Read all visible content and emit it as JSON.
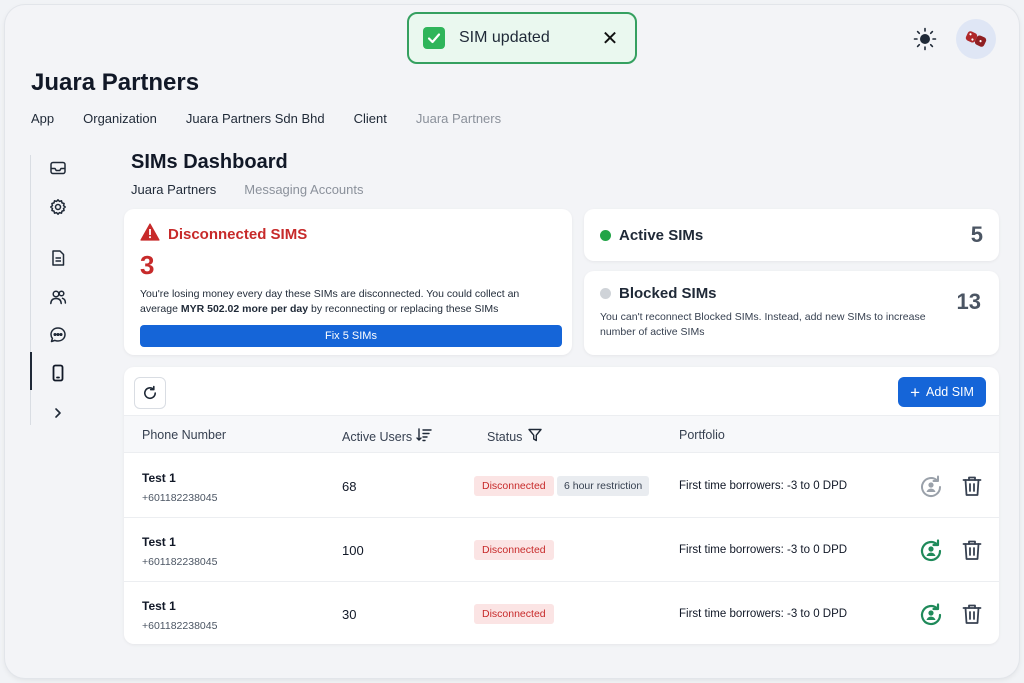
{
  "toast": {
    "message": "SIM updated",
    "close_label": "✕"
  },
  "header": {
    "org_title": "Juara Partners"
  },
  "breadcrumb": [
    "App",
    "Organization",
    "Juara Partners Sdn Bhd",
    "Client",
    "Juara Partners"
  ],
  "sidebar": {
    "items": [
      {
        "icon": "inbox-icon"
      },
      {
        "icon": "gear-icon"
      },
      {
        "icon": "document-icon"
      },
      {
        "icon": "users-icon"
      },
      {
        "icon": "chat-icon"
      },
      {
        "icon": "phone-icon",
        "active": true
      },
      {
        "icon": "chevron-right-icon"
      }
    ]
  },
  "dashboard": {
    "title": "SIMs Dashboard",
    "tabs": [
      "Juara Partners",
      "Messaging Accounts"
    ]
  },
  "disconnected": {
    "title": "Disconnected SIMS",
    "count": "3",
    "message_pre": "You're losing money every day these SIMs are disconnected. You could collect an average ",
    "message_bold": "MYR 502.02 more per day",
    "message_post": " by reconnecting or replacing these SIMs",
    "button_label": "Fix 5 SIMs",
    "color": "#c72a2a"
  },
  "active": {
    "label": "Active SIMs",
    "count": "5",
    "color": "#22a447"
  },
  "blocked": {
    "label": "Blocked SIMs",
    "count": "13",
    "message": "You can't reconnect Blocked SIMs. Instead, add new SIMs to increase number of active SIMs",
    "color": "#cfd3d8"
  },
  "table": {
    "add_label": "Add SIM",
    "columns": [
      "Phone Number",
      "Active Users",
      "Status",
      "Portfolio"
    ],
    "rows": [
      {
        "name": "Test 1",
        "number": "+601182238045",
        "users": "68",
        "status": "Disconnected",
        "restriction": "6 hour restriction",
        "portfolio": "First time borrowers: -3 to 0 DPD",
        "reconnect_enabled": false
      },
      {
        "name": "Test 1",
        "number": "+601182238045",
        "users": "100",
        "status": "Disconnected",
        "restriction": "",
        "portfolio": "First time borrowers: -3 to 0 DPD",
        "reconnect_enabled": true
      },
      {
        "name": "Test 1",
        "number": "+601182238045",
        "users": "30",
        "status": "Disconnected",
        "restriction": "",
        "portfolio": "First time borrowers: -3 to 0 DPD",
        "reconnect_enabled": true
      }
    ]
  },
  "colors": {
    "primary": "#1565d8",
    "success": "#1f8a5a",
    "danger": "#c72a2a"
  }
}
